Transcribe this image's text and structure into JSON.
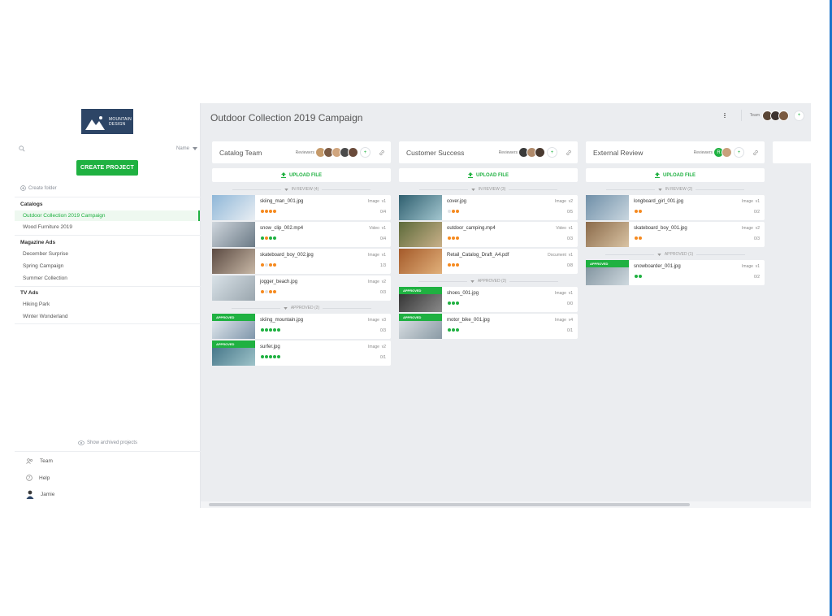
{
  "brand": {
    "logo_line1": "MOUNTAIN",
    "logo_line2": "DESIGN"
  },
  "sidebar": {
    "search_placeholder": "",
    "sort_label": "Name",
    "create_project": "CREATE PROJECT",
    "create_folder": "Create folder",
    "groups": [
      {
        "title": "Catalogs",
        "items": [
          "Outdoor Collection 2019 Campaign",
          "Wood Furniture 2019"
        ]
      },
      {
        "title": "Magazine Ads",
        "items": [
          "December Surprise",
          "Spring Campaign",
          "Summer Collection"
        ]
      },
      {
        "title": "TV Ads",
        "items": [
          "Hiking Park",
          "Winter Wonderland"
        ]
      }
    ],
    "show_archived": "Show archived projects",
    "bottom": {
      "team": "Team",
      "help": "Help",
      "user": "Jamie"
    }
  },
  "header": {
    "title": "Outdoor Collection 2019 Campaign",
    "team_label": "Team"
  },
  "columns": [
    {
      "title": "Catalog Team",
      "reviewers_label": "Reviewers",
      "upload_label": "UPLOAD FILE",
      "sections": [
        {
          "label": "IN REVIEW (4)",
          "cards": [
            {
              "name": "skiing_man_001.jpg",
              "type": "Image",
              "version": "v1",
              "count": "0/4",
              "approved": false,
              "dots": [
                "o",
                "o",
                "o",
                "o"
              ]
            },
            {
              "name": "snow_clip_002.mp4",
              "type": "Video",
              "version": "v1",
              "count": "0/4",
              "approved": false,
              "dots": [
                "g",
                "o",
                "g",
                "g"
              ]
            },
            {
              "name": "skateboard_boy_002.jpg",
              "type": "Image",
              "version": "v1",
              "count": "1/3",
              "approved": false,
              "dots": [
                "o",
                "l",
                "o",
                "o"
              ]
            },
            {
              "name": "jogger_beach.jpg",
              "type": "Image",
              "version": "v2",
              "count": "0/3",
              "approved": false,
              "dots": [
                "o",
                "l",
                "o",
                "o"
              ]
            }
          ]
        },
        {
          "label": "APPROVED (2)",
          "cards": [
            {
              "name": "skiing_mountain.jpg",
              "type": "Image",
              "version": "v3",
              "count": "0/3",
              "approved": true,
              "dots": [
                "g",
                "g",
                "g",
                "g",
                "g"
              ]
            },
            {
              "name": "surfer.jpg",
              "type": "Image",
              "version": "v2",
              "count": "0/1",
              "approved": true,
              "dots": [
                "g",
                "g",
                "g",
                "g",
                "g"
              ]
            }
          ]
        }
      ]
    },
    {
      "title": "Customer Success",
      "reviewers_label": "Reviewers",
      "upload_label": "UPLOAD FILE",
      "sections": [
        {
          "label": "IN REVIEW (3)",
          "cards": [
            {
              "name": "cover.jpg",
              "type": "Image",
              "version": "v2",
              "count": "0/5",
              "approved": false,
              "dots": [
                "l",
                "o",
                "o"
              ]
            },
            {
              "name": "outdoor_camping.mp4",
              "type": "Video",
              "version": "v1",
              "count": "0/3",
              "approved": false,
              "dots": [
                "o",
                "o",
                "o"
              ]
            },
            {
              "name": "Retail_Catalog_Draft_A4.pdf",
              "type": "Document",
              "version": "v1",
              "count": "0/8",
              "approved": false,
              "dots": [
                "o",
                "o",
                "o"
              ]
            }
          ]
        },
        {
          "label": "APPROVED (2)",
          "cards": [
            {
              "name": "shoes_001.jpg",
              "type": "Image",
              "version": "v1",
              "count": "0/0",
              "approved": true,
              "dots": [
                "g",
                "g",
                "g"
              ]
            },
            {
              "name": "motor_bike_001.jpg",
              "type": "Image",
              "version": "v4",
              "count": "0/1",
              "approved": true,
              "dots": [
                "g",
                "g",
                "g"
              ]
            }
          ]
        }
      ]
    },
    {
      "title": "External Review",
      "reviewers_label": "Reviewers",
      "upload_label": "UPLOAD FILE",
      "sections": [
        {
          "label": "IN REVIEW (2)",
          "cards": [
            {
              "name": "longboard_girl_001.jpg",
              "type": "Image",
              "version": "v1",
              "count": "0/2",
              "approved": false,
              "dots": [
                "o",
                "o"
              ]
            },
            {
              "name": "skateboard_boy_001.jpg",
              "type": "Image",
              "version": "v2",
              "count": "0/3",
              "approved": false,
              "dots": [
                "o",
                "o"
              ]
            }
          ]
        },
        {
          "label": "APPROVED (1)",
          "cards": [
            {
              "name": "snowboarder_001.jpg",
              "type": "Image",
              "version": "v1",
              "count": "0/2",
              "approved": true,
              "dots": [
                "g",
                "g"
              ]
            }
          ]
        }
      ]
    }
  ],
  "approved_tag": "APPROVED",
  "reviewer_initial": "R",
  "colors": {
    "accent_green": "#1fb141",
    "review_orange": "#f58a1f",
    "logo_navy": "#2d4566",
    "frame_blue": "#1a73c9"
  }
}
